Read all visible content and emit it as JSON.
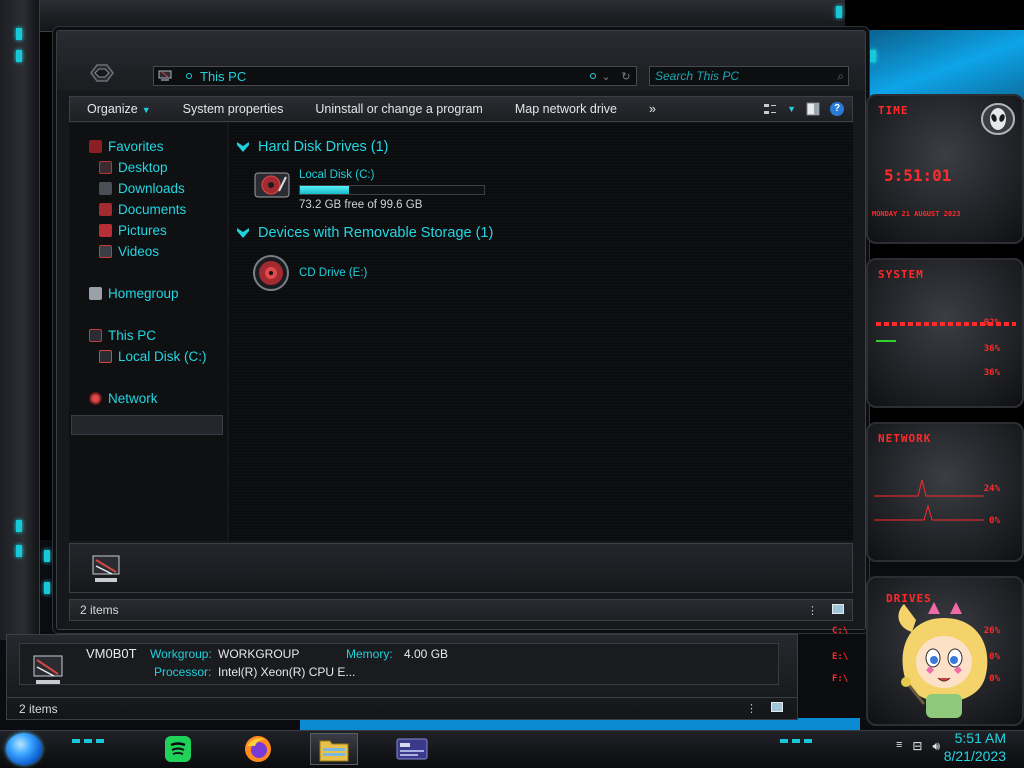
{
  "colors": {
    "accent_cyan": "#1fd1dd",
    "window_bg": "#17181c",
    "gadget_red": "#ff2a2a",
    "capacity_fill": "#3ad8e6"
  },
  "explorer": {
    "address": "This PC",
    "search_placeholder": "Search This PC",
    "toolbar": {
      "organize": "Organize",
      "system_properties": "System properties",
      "uninstall": "Uninstall or change a program",
      "map_drive": "Map network drive",
      "more": "»"
    },
    "nav": {
      "favorites": "Favorites",
      "desktop": "Desktop",
      "downloads": "Downloads",
      "documents": "Documents",
      "pictures": "Pictures",
      "videos": "Videos",
      "homegroup": "Homegroup",
      "this_pc": "This PC",
      "local_disk": "Local Disk (C:)",
      "network": "Network"
    },
    "groups": {
      "hdd": "Hard Disk Drives (1)",
      "removable": "Devices with Removable Storage (1)"
    },
    "drives": {
      "c_name": "Local Disk (C:)",
      "c_free": "73.2 GB free of 99.6 GB",
      "c_used_fraction": 0.265,
      "e_name": "CD Drive (E:)"
    },
    "status": "2 items"
  },
  "lower_window": {
    "hostname": "VM0B0T",
    "workgroup_label": "Workgroup:",
    "workgroup_value": "WORKGROUP",
    "memory_label": "Memory:",
    "memory_value": "4.00 GB",
    "processor_label": "Processor:",
    "processor_value": "Intel(R) Xeon(R) CPU E...",
    "status": "2 items"
  },
  "gadgets": {
    "time_header": "TIME",
    "time": "5:51:01",
    "date": "MONDAY 21 AUGUST 2023",
    "system_header": "SYSTEM",
    "sys_values": [
      "92%",
      "36%",
      "36%"
    ],
    "network_header": "NETWORK",
    "net_values": [
      "24%",
      "0%"
    ],
    "drives_header": "DRIVES",
    "drive_rows": [
      {
        "letter": "C:\\",
        "value": "26%"
      },
      {
        "letter": "E:\\",
        "value": "0%"
      },
      {
        "letter": "F:\\",
        "value": "0%"
      }
    ]
  },
  "taskbar": {
    "clock_time": "5:51 AM",
    "clock_date": "8/21/2023",
    "apps": [
      "spotify-icon",
      "firefox-icon",
      "file-explorer-icon",
      "control-panel-icon"
    ]
  }
}
